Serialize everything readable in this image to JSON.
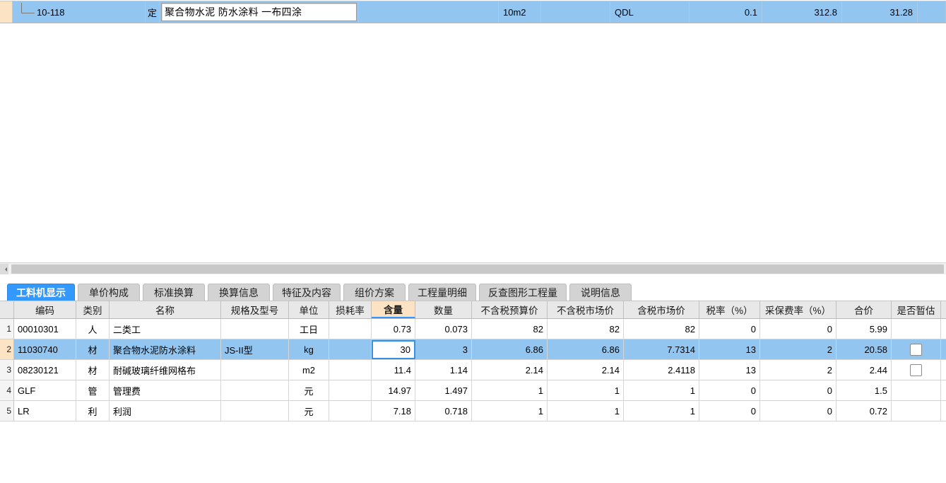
{
  "top_row": {
    "code": "10-118",
    "category": "定",
    "name_editor_value": "聚合物水泥 防水涂料 一布四涂",
    "unit": "10m2",
    "qty_expr": "QDL",
    "quantity": "0.1",
    "price": "312.8",
    "total": "31.28"
  },
  "tabs": [
    {
      "label": "工料机显示",
      "active": true
    },
    {
      "label": "单价构成",
      "active": false
    },
    {
      "label": "标准换算",
      "active": false
    },
    {
      "label": "换算信息",
      "active": false
    },
    {
      "label": "特征及内容",
      "active": false
    },
    {
      "label": "组价方案",
      "active": false
    },
    {
      "label": "工程量明细",
      "active": false
    },
    {
      "label": "反查图形工程量",
      "active": false
    },
    {
      "label": "说明信息",
      "active": false
    }
  ],
  "grid": {
    "headers": [
      "编码",
      "类别",
      "名称",
      "规格及型号",
      "单位",
      "损耗率",
      "含量",
      "数量",
      "不含税预算价",
      "不含税市场价",
      "含税市场价",
      "税率（%）",
      "采保费率（%）",
      "合价",
      "是否暂估"
    ],
    "highlighted_header": "含量",
    "rows": [
      {
        "index": "1",
        "code": "00010301",
        "category": "人",
        "name": "二类工",
        "spec": "",
        "unit": "工日",
        "loss_rate": "",
        "content": "0.73",
        "quantity": "0.073",
        "budget_price_excl_tax": "82",
        "market_price_excl_tax": "82",
        "market_price_incl_tax": "82",
        "tax_rate": "0",
        "procure_rate": "0",
        "amount": "5.99",
        "provisional": false,
        "has_checkbox": false,
        "selected": false
      },
      {
        "index": "2",
        "code": "11030740",
        "category": "材",
        "name": "聚合物水泥防水涂料",
        "spec": "JS-II型",
        "unit": "kg",
        "loss_rate": "",
        "content": "30",
        "quantity": "3",
        "budget_price_excl_tax": "6.86",
        "market_price_excl_tax": "6.86",
        "market_price_incl_tax": "7.7314",
        "tax_rate": "13",
        "procure_rate": "2",
        "amount": "20.58",
        "provisional": false,
        "has_checkbox": true,
        "selected": true
      },
      {
        "index": "3",
        "code": "08230121",
        "category": "材",
        "name": "耐碱玻璃纤维网格布",
        "spec": "",
        "unit": "m2",
        "loss_rate": "",
        "content": "11.4",
        "quantity": "1.14",
        "budget_price_excl_tax": "2.14",
        "market_price_excl_tax": "2.14",
        "market_price_incl_tax": "2.4118",
        "tax_rate": "13",
        "procure_rate": "2",
        "amount": "2.44",
        "provisional": false,
        "has_checkbox": true,
        "selected": false
      },
      {
        "index": "4",
        "code": "GLF",
        "category": "管",
        "name": "管理费",
        "spec": "",
        "unit": "元",
        "loss_rate": "",
        "content": "14.97",
        "quantity": "1.497",
        "budget_price_excl_tax": "1",
        "market_price_excl_tax": "1",
        "market_price_incl_tax": "1",
        "tax_rate": "0",
        "procure_rate": "0",
        "amount": "1.5",
        "provisional": false,
        "has_checkbox": false,
        "selected": false
      },
      {
        "index": "5",
        "code": "LR",
        "category": "利",
        "name": "利润",
        "spec": "",
        "unit": "元",
        "loss_rate": "",
        "content": "7.18",
        "quantity": "0.718",
        "budget_price_excl_tax": "1",
        "market_price_excl_tax": "1",
        "market_price_incl_tax": "1",
        "tax_rate": "0",
        "procure_rate": "0",
        "amount": "0.72",
        "provisional": false,
        "has_checkbox": false,
        "selected": false
      }
    ]
  },
  "colors": {
    "selection_blue": "#92c5f0",
    "active_tab_blue": "#3399ff",
    "highlight_peach": "#fde3c4",
    "header_gray": "#e8e8e8"
  }
}
